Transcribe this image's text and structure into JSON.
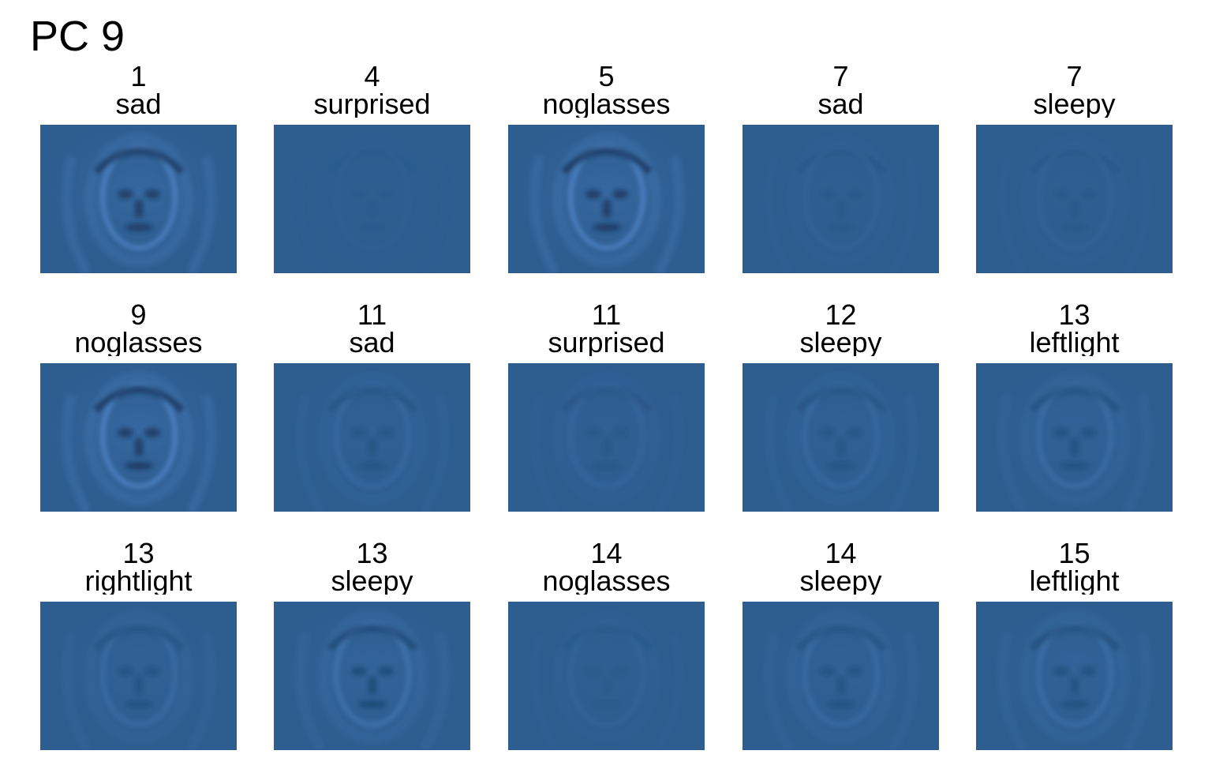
{
  "title": "PC 9",
  "panel_color": "#2e5d90",
  "panels": [
    {
      "subject": "1",
      "condition": "sad",
      "contrast": 0.95
    },
    {
      "subject": "4",
      "condition": "surprised",
      "contrast": 0.08
    },
    {
      "subject": "5",
      "condition": "noglasses",
      "contrast": 1.0
    },
    {
      "subject": "7",
      "condition": "sad",
      "contrast": 0.12
    },
    {
      "subject": "7",
      "condition": "sleepy",
      "contrast": 0.12
    },
    {
      "subject": "9",
      "condition": "noglasses",
      "contrast": 1.0
    },
    {
      "subject": "11",
      "condition": "sad",
      "contrast": 0.3
    },
    {
      "subject": "11",
      "condition": "surprised",
      "contrast": 0.22
    },
    {
      "subject": "12",
      "condition": "sleepy",
      "contrast": 0.3
    },
    {
      "subject": "13",
      "condition": "leftlight",
      "contrast": 0.4
    },
    {
      "subject": "13",
      "condition": "rightlight",
      "contrast": 0.35
    },
    {
      "subject": "13",
      "condition": "sleepy",
      "contrast": 0.6
    },
    {
      "subject": "14",
      "condition": "noglasses",
      "contrast": 0.15
    },
    {
      "subject": "14",
      "condition": "sleepy",
      "contrast": 0.35
    },
    {
      "subject": "15",
      "condition": "leftlight",
      "contrast": 0.45
    }
  ]
}
